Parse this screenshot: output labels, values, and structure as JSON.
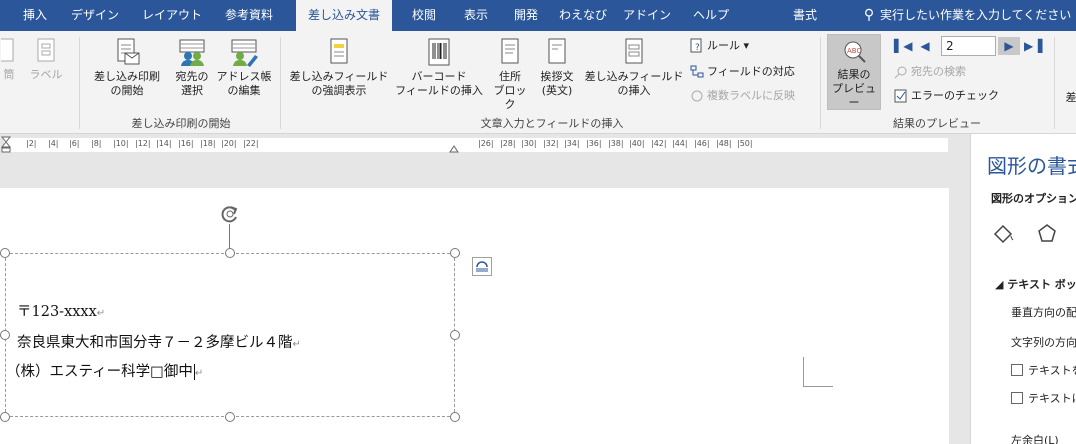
{
  "tabs": [
    {
      "label": "挿入",
      "active": false
    },
    {
      "label": "デザイン",
      "active": false
    },
    {
      "label": "レイアウト",
      "active": false
    },
    {
      "label": "参考資料",
      "active": false
    },
    {
      "label": "差し込み文書",
      "active": true
    },
    {
      "label": "校閲",
      "active": false
    },
    {
      "label": "表示",
      "active": false
    },
    {
      "label": "開発",
      "active": false
    },
    {
      "label": "わえなび",
      "active": false
    },
    {
      "label": "アドイン",
      "active": false
    },
    {
      "label": "ヘルプ",
      "active": false
    },
    {
      "label": "書式",
      "active": false
    }
  ],
  "tell_me": "実行したい作業を入力してください",
  "ribbon": {
    "create_group": {
      "envelope": "筒",
      "labels": "ラベル"
    },
    "start_group": {
      "label": "差し込み印刷の開始",
      "start_merge": "差し込み印刷\nの開始",
      "select_recipients": "宛先の\n選択",
      "edit_list": "アドレス帳\nの編集"
    },
    "write_group": {
      "label": "文章入力とフィールドの挿入",
      "highlight_fields": "差し込みフィールド\nの強調表示",
      "barcode": "バーコード\nフィールドの挿入",
      "address_block": "住所\nブロック",
      "greeting_line": "挨拶文\n(英文)",
      "insert_field": "差し込みフィールド\nの挿入",
      "rules": "ルール",
      "match_fields": "フィールドの対応",
      "update_labels": "複数ラベルに反映"
    },
    "preview_group": {
      "label": "結果のプレビュー",
      "preview_results": "結果の\nプレビュー",
      "record": "2",
      "find_recipient": "宛先の検索",
      "check_errors": "エラーのチェック"
    },
    "finish_partial": "差"
  },
  "ruler_ticks": [
    "2",
    "4",
    "6",
    "8",
    "10",
    "12",
    "14",
    "16",
    "18",
    "20",
    "22",
    "26",
    "28",
    "30",
    "32",
    "34",
    "36",
    "38",
    "40",
    "42",
    "44",
    "46",
    "48",
    "50"
  ],
  "address": {
    "postal": "〒123-xxxx",
    "street": "奈良県東大和市国分寺７－２多摩ビル４階",
    "company": "（株）エスティー科学□御中"
  },
  "pane": {
    "title": "図形の書式設定",
    "subtab": "図形のオプション",
    "section": "テキスト ボックス",
    "vertical_align": "垂直方向の配置",
    "text_direction": "文字列の方向",
    "option1": "テキストを回転させない",
    "option2": "テキストに合わせて図形のサイズを調整する(E)",
    "next": "左余白(L)"
  },
  "colors": {
    "accent": "#2b579a",
    "ribbon_bg": "#f3f3f3"
  }
}
